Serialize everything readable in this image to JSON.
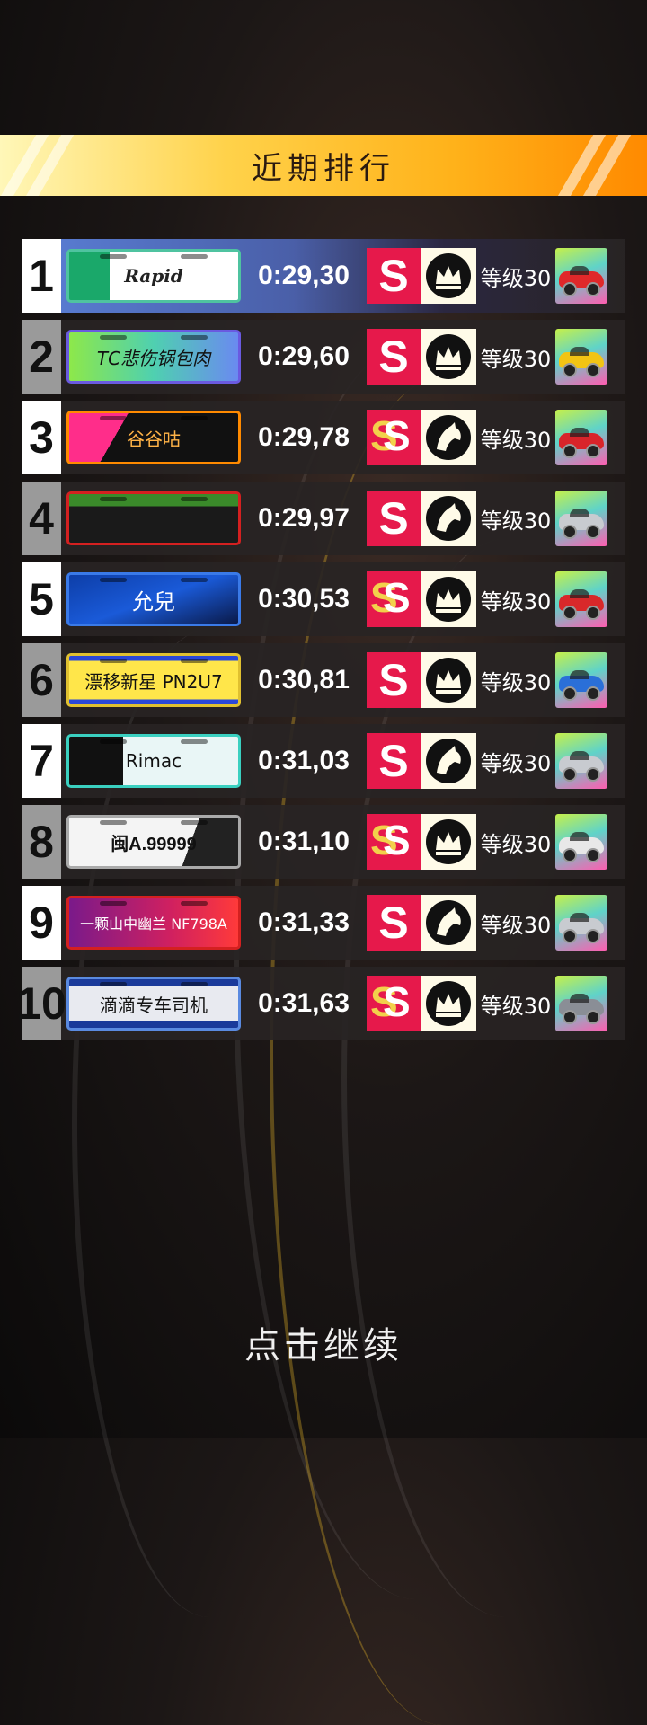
{
  "title": "近期排行",
  "continue_label": "点击继续",
  "rows": [
    {
      "rank": "1",
      "plate": "Rapid",
      "time": "0:29,30",
      "grade": "S",
      "emblem": "crown-icon",
      "level": "等级30",
      "car_color": "#e0282a"
    },
    {
      "rank": "2",
      "plate": "TC悲伤锅包肉",
      "time": "0:29,60",
      "grade": "S",
      "emblem": "crown-icon",
      "level": "等级30",
      "car_color": "#f2c414"
    },
    {
      "rank": "3",
      "plate": "谷谷咕",
      "time": "0:29,78",
      "grade": "SS",
      "emblem": "horse-icon",
      "level": "等级30",
      "car_color": "#d8242a"
    },
    {
      "rank": "4",
      "plate": "",
      "time": "0:29,97",
      "grade": "S",
      "emblem": "horse-icon",
      "level": "等级30",
      "car_color": "#c8cbd0"
    },
    {
      "rank": "5",
      "plate": "允兒",
      "time": "0:30,53",
      "grade": "SS",
      "emblem": "crown-icon",
      "level": "等级30",
      "car_color": "#d8282a"
    },
    {
      "rank": "6",
      "plate": "漂移新星 PN2U7",
      "time": "0:30,81",
      "grade": "S",
      "emblem": "crown-icon",
      "level": "等级30",
      "car_color": "#2a6fd8"
    },
    {
      "rank": "7",
      "plate": "Rimac",
      "time": "0:31,03",
      "grade": "S",
      "emblem": "horse-icon",
      "level": "等级30",
      "car_color": "#c8cbd0"
    },
    {
      "rank": "8",
      "plate": "闽A.99999",
      "time": "0:31,10",
      "grade": "SS",
      "emblem": "crown-icon",
      "level": "等级30",
      "car_color": "#e8e8e8"
    },
    {
      "rank": "9",
      "plate": "一颗山中幽兰 NF798A",
      "time": "0:31,33",
      "grade": "S",
      "emblem": "horse-icon",
      "level": "等级30",
      "car_color": "#c8cbd0"
    },
    {
      "rank": "10",
      "plate": "滴滴专车司机",
      "time": "0:31,63",
      "grade": "SS",
      "emblem": "crown-icon",
      "level": "等级30",
      "car_color": "#8a8e96"
    }
  ]
}
